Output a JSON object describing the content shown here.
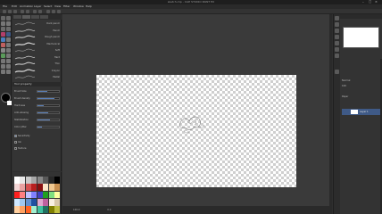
{
  "window": {
    "title": "sketch.clip - CLIP STUDIO PAINT EX",
    "controls": [
      "–",
      "□",
      "×"
    ]
  },
  "menu": [
    "File",
    "Edit",
    "Animation",
    "Layer",
    "Select",
    "View",
    "Filter",
    "Window",
    "Help"
  ],
  "subtool": {
    "brushes": [
      {
        "label": "Dark pencil"
      },
      {
        "label": "Pencil"
      },
      {
        "label": "Rough pencil"
      },
      {
        "label": "Mechanical"
      },
      {
        "label": "Soft"
      },
      {
        "label": "Hard"
      },
      {
        "label": "Thin"
      },
      {
        "label": "Crayon"
      },
      {
        "label": "Pastel"
      },
      {
        "label": "Real pencil"
      },
      {
        "label": "Sketch"
      }
    ]
  },
  "tool_property": {
    "title": "Tool property",
    "rows": [
      {
        "label": "Brush Size",
        "value": 0.45
      },
      {
        "label": "Brush density",
        "value": 0.8
      },
      {
        "label": "Hardness",
        "value": 0.3
      },
      {
        "label": "Anti-aliasing",
        "value": 0.5
      },
      {
        "label": "Stabilization",
        "value": 0.6
      },
      {
        "label": "Color jitter",
        "value": 0.2
      }
    ],
    "checks": [
      {
        "label": "Sensitivity",
        "on": true
      },
      {
        "label": "Ink",
        "on": false
      },
      {
        "label": "Texture",
        "on": false
      }
    ]
  },
  "color_set": {
    "colors": [
      "#ffffff",
      "#e8e8e8",
      "#c8c8c8",
      "#a8a8a8",
      "#888888",
      "#585858",
      "#282828",
      "#000000",
      "#f2d6d6",
      "#e8a0a0",
      "#d45050",
      "#b82020",
      "#881010",
      "#fbe6c8",
      "#f0c890",
      "#c89050",
      "#ff2020",
      "#ff8080",
      "#c0c0ff",
      "#8080ff",
      "#4040c0",
      "#20a020",
      "#80e080",
      "#ffffa0",
      "#d0e8ff",
      "#a0c8f0",
      "#6090d0",
      "#2050a0",
      "#e0a8d0",
      "#c060a0",
      "#f8f0e0",
      "#d8c8a8",
      "#ffd0a0",
      "#ffa060",
      "#ff6020",
      "#a0f0d0",
      "#40c0a0",
      "#207060",
      "#808000",
      "#c0c040"
    ]
  },
  "status": {
    "zoom": "100.0",
    "angle": "0.0"
  },
  "layers": {
    "selected_name": "Layer 1",
    "items": [
      {
        "label": "Normal"
      },
      {
        "label": "100"
      },
      {
        "label": "Paper"
      }
    ]
  },
  "accent": "#3f5a87"
}
